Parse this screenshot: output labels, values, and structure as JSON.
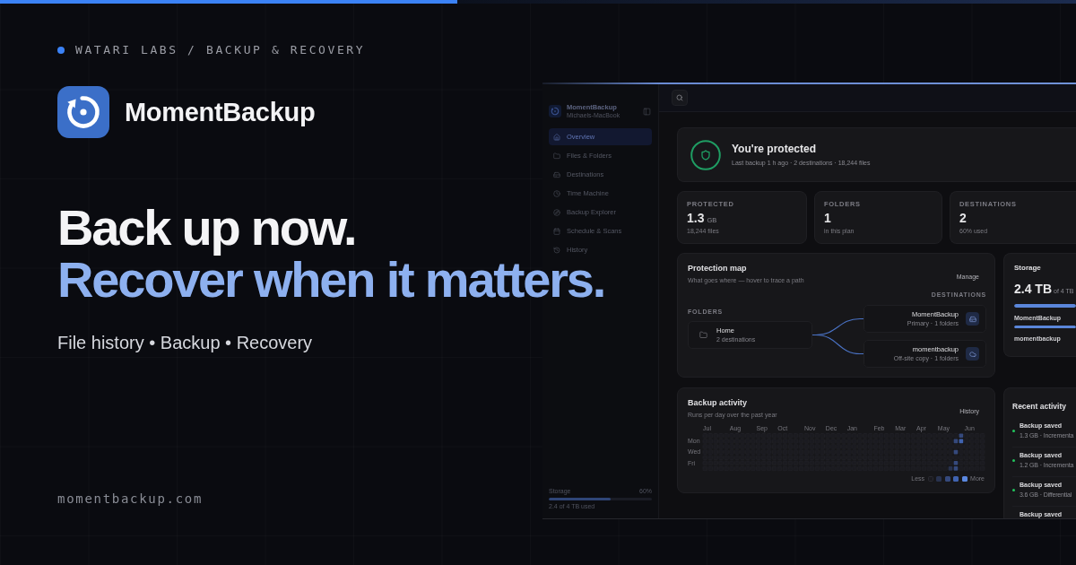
{
  "eyebrow": {
    "text": "WATARI LABS / BACKUP & RECOVERY"
  },
  "brand": {
    "name": "MomentBackup"
  },
  "headline": [
    {
      "text": "Back up now.",
      "kind": "plain"
    },
    {
      "text": "Recover when it matters.",
      "kind": "accent"
    }
  ],
  "tagline": "File history • Backup • Recovery",
  "website": "momentbackup.com",
  "dashboard": {
    "sidebar": {
      "app_name": "MomentBackup",
      "device": "Michaels-MacBook",
      "items": [
        {
          "label": "Overview",
          "selected": true
        },
        {
          "label": "Files & Folders",
          "selected": false
        },
        {
          "label": "Destinations",
          "selected": false
        },
        {
          "label": "Time Machine",
          "selected": false
        },
        {
          "label": "Backup Explorer",
          "selected": false
        },
        {
          "label": "Schedule & Scans",
          "selected": false
        },
        {
          "label": "History",
          "selected": false
        }
      ],
      "storage": {
        "label": "Storage",
        "percent": "60%",
        "level": 0.6,
        "detail": "2.4 of 4 TB used"
      }
    },
    "hero": {
      "title": "You're protected",
      "subtitle": "Last backup 1 h ago · 2 destinations · 18,244 files"
    },
    "stats": [
      {
        "label": "PROTECTED",
        "value": "1.3",
        "unit": "GB",
        "detail": "18,244 files"
      },
      {
        "label": "FOLDERS",
        "value": "1",
        "detail": "in this plan"
      },
      {
        "label": "DESTINATIONS",
        "value": "2",
        "detail": "60% used"
      }
    ],
    "protection_map": {
      "title": "Protection map",
      "subtitle": "What goes where — hover to trace a path",
      "action": "Manage",
      "folders_label": "FOLDERS",
      "destinations_label": "DESTINATIONS",
      "folders": [
        {
          "name": "Home",
          "detail": "2 destinations"
        }
      ],
      "destinations": [
        {
          "name": "MomentBackup",
          "detail": "Primary · 1 folders",
          "kind": "drive"
        },
        {
          "name": "momentbackup",
          "detail": "Off-site copy · 1 folders",
          "kind": "cloud"
        }
      ]
    },
    "storage": {
      "title": "Storage",
      "value": "2.4 TB",
      "detail": "of 4 TB",
      "level": 1,
      "destinations": [
        {
          "name": "MomentBackup",
          "level": 1
        },
        {
          "name": "momentbackup"
        }
      ]
    },
    "backup_activity": {
      "title": "Backup activity",
      "subtitle": "Runs per day over the past year",
      "action": "History",
      "months": [
        "Jul",
        "Aug",
        "Sep",
        "Oct",
        "Nov",
        "Dec",
        "Jan",
        "Feb",
        "Mar",
        "Apr",
        "May",
        "Jun"
      ],
      "days": [
        "Mon",
        "Wed",
        "Fri"
      ],
      "legend": {
        "less": "Less",
        "more": "More",
        "swatches": [
          {
            "color": "#1b1b20"
          },
          {
            "color": "#28324e"
          },
          {
            "color": "#35497c"
          },
          {
            "color": "#4063b0"
          },
          {
            "color": "#5b88e0"
          }
        ]
      }
    },
    "recent_activity": {
      "title": "Recent activity",
      "items": [
        {
          "title": "Backup saved",
          "detail": "1.3 GB · Incrementa"
        },
        {
          "title": "Backup saved",
          "detail": "1.2 GB · Incrementa"
        },
        {
          "title": "Backup saved",
          "detail": "3.6 GB · Differential"
        },
        {
          "title": "Backup saved"
        }
      ]
    }
  }
}
